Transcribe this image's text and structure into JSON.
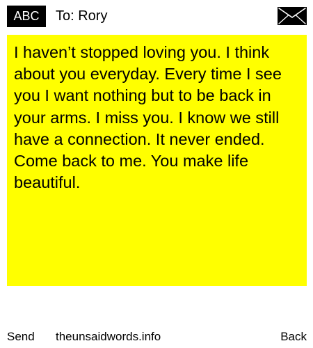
{
  "header": {
    "mode_badge": "ABC",
    "recipient_label": "To: Rory",
    "compose_icon": "envelope-icon"
  },
  "message": {
    "text": "I haven’t stopped loving you. I think about you everyday. Every time I see you I want nothing but to be back in your arms. I miss you. I know we still have a connection. It never ended. Come back to me. You make life beautiful.",
    "background_color": "#ffff00"
  },
  "footer": {
    "send_label": "Send",
    "site_label": "theunsaidwords.info",
    "back_label": "Back"
  }
}
